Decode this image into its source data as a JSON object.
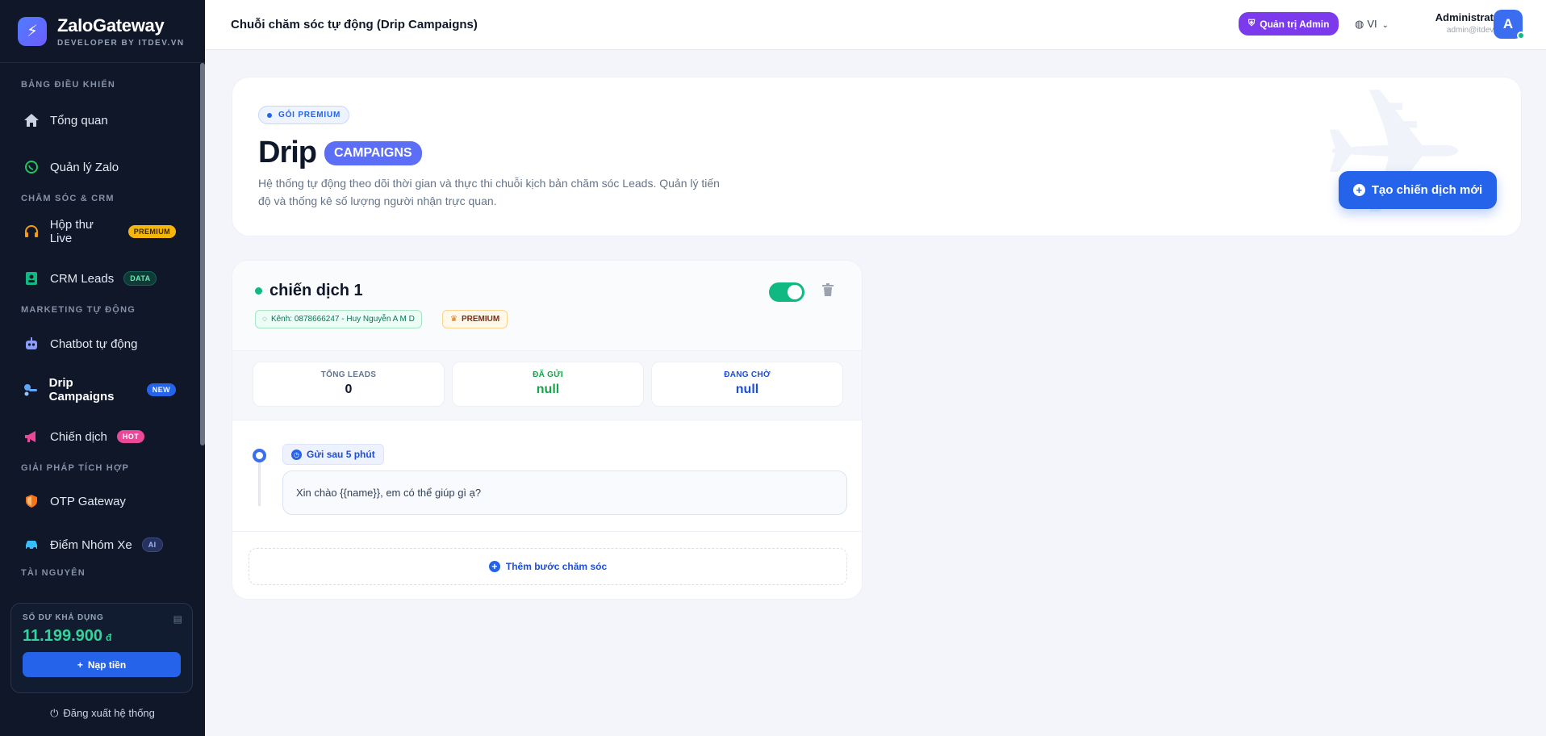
{
  "brand": {
    "title": "ZaloGateway",
    "subtitle": "DEVELOPER BY ITDEV.VN"
  },
  "sidebar": {
    "sections": [
      {
        "label": "BẢNG ĐIỀU KHIỂN"
      },
      {
        "label": "CHĂM SÓC & CRM"
      },
      {
        "label": "MARKETING TỰ ĐỘNG"
      },
      {
        "label": "GIẢI PHÁP TÍCH HỢP"
      },
      {
        "label": "TÀI NGUYÊN"
      }
    ],
    "items": [
      {
        "label": "Tổng quan",
        "icon": "home-icon"
      },
      {
        "label": "Quản lý Zalo",
        "icon": "whatsapp-icon"
      },
      {
        "label": "Hộp thư Live",
        "icon": "headset-icon",
        "badge": "PREMIUM"
      },
      {
        "label": "CRM Leads",
        "icon": "contact-book-icon",
        "badge": "DATA"
      },
      {
        "label": "Chatbot tự động",
        "icon": "robot-icon"
      },
      {
        "label": "Drip Campaigns",
        "icon": "drip-icon",
        "badge": "NEW"
      },
      {
        "label": "Chiến dịch",
        "icon": "megaphone-icon",
        "badge": "HOT"
      },
      {
        "label": "OTP Gateway",
        "icon": "shield-icon"
      },
      {
        "label": "Điểm Nhóm Xe",
        "icon": "car-icon",
        "badge": "AI"
      }
    ],
    "wallet": {
      "label": "SỐ DƯ KHẢ DỤNG",
      "amount": "11.199.900",
      "currency": "đ",
      "topup_label": "Nạp tiền"
    },
    "logout_label": "Đăng xuất hệ thống"
  },
  "header": {
    "title": "Chuỗi chăm sóc tự động (Drip Campaigns)",
    "admin_label": "Quản trị Admin",
    "lang": "VI",
    "user_name": "Administrator",
    "user_email": "admin@itdev.vn",
    "avatar_letter": "A"
  },
  "hero": {
    "package": "GÓI PREMIUM",
    "title_main": "Drip",
    "title_badge": "CAMPAIGNS",
    "description": "Hệ thống tự động theo dõi thời gian và thực thi chuỗi kịch bản chăm sóc Leads. Quản lý tiến độ và thống kê số lượng người nhận trực quan.",
    "create_label": "Tạo chiến dịch mới"
  },
  "campaign": {
    "name": "chiến dịch 1",
    "channel": "Kênh: 0878666247 - Huy Nguyễn A M D",
    "tier": "PREMIUM",
    "enabled": true,
    "stats": [
      {
        "label": "TỔNG LEADS",
        "value": "0",
        "color": "#0f172a"
      },
      {
        "label": "ĐÃ GỬI",
        "value": "null",
        "color": "#16a34a"
      },
      {
        "label": "ĐANG CHỜ",
        "value": "null",
        "color": "#1d4ed8"
      }
    ],
    "steps": [
      {
        "delay": "Gửi sau 5 phút",
        "message": "Xin chào {{name}}, em có thể giúp gì ạ?"
      }
    ],
    "add_step_label": "Thêm bước chăm sóc"
  },
  "colors": {
    "accent": "#2563eb",
    "sidebar_bg": "#0f1729",
    "success": "#10b981"
  }
}
